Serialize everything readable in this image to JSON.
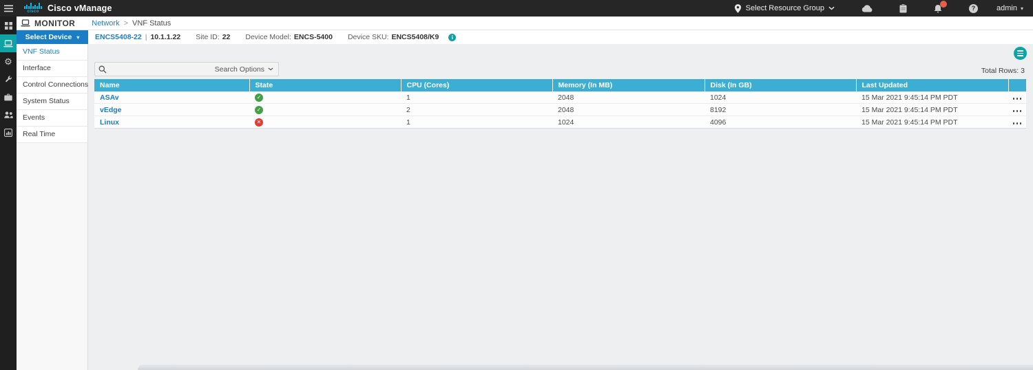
{
  "topbar": {
    "logo_text": "cisco",
    "brand": "Cisco vManage",
    "resource_group_label": "Select Resource Group",
    "username": "admin"
  },
  "titlebar": {
    "section": "MONITOR",
    "breadcrumb_parent": "Network",
    "breadcrumb_separator": ">",
    "breadcrumb_current": "VNF Status"
  },
  "sidebar": {
    "select_device_label": "Select Device",
    "active_item": "VNF Status",
    "items": [
      "VNF Status",
      "Interface",
      "Control Connections",
      "System Status",
      "Events",
      "Real Time"
    ]
  },
  "device_bar": {
    "device_name": "ENCS5408-22",
    "separator": "|",
    "ip": "10.1.1.22",
    "site_id_label": "Site ID:",
    "site_id_value": "22",
    "model_label": "Device Model:",
    "model_value": "ENCS-5400",
    "sku_label": "Device SKU:",
    "sku_value": "ENCS5408/K9"
  },
  "toolbar": {
    "search_value": "",
    "search_options_label": "Search Options",
    "total_rows_label": "Total Rows:",
    "total_rows_value": "3"
  },
  "table": {
    "columns": [
      "Name",
      "State",
      "CPU (Cores)",
      "Memory (In MB)",
      "Disk (In GB)",
      "Last Updated",
      ""
    ],
    "rows": [
      {
        "name": "ASAv",
        "state": "up",
        "cpu": "1",
        "memory": "2048",
        "disk": "1024",
        "last_updated": "15 Mar 2021 9:45:14 PM PDT"
      },
      {
        "name": "vEdge",
        "state": "up",
        "cpu": "2",
        "memory": "2048",
        "disk": "8192",
        "last_updated": "15 Mar 2021 9:45:14 PM PDT"
      },
      {
        "name": "Linux",
        "state": "down",
        "cpu": "1",
        "memory": "1024",
        "disk": "4096",
        "last_updated": "15 Mar 2021 9:45:14 PM PDT"
      }
    ]
  },
  "icons": {
    "hamburger-menu": "three horizontal bars",
    "apps-grid": "grid of squares",
    "monitor": "laptop screen (active, teal)",
    "configuration": "gear",
    "tools": "wrench",
    "maintenance": "toolbox",
    "administration": "two users",
    "analytics": "bar chart panel",
    "location-pin": "map pin",
    "cloud": "cloud",
    "tasks": "clipboard",
    "notifications": "bell with red badge",
    "help": "question mark circle",
    "search": "magnifier",
    "table-menu": "list lines in teal circle",
    "row-actions": "horizontal ellipsis",
    "info": "i in teal circle",
    "status-up": "white check in green circle",
    "status-down": "white cross in red circle"
  },
  "colors": {
    "accent_blue": "#1b7dc3",
    "brand_cyan": "#00bceb",
    "teal": "#0fa3a3",
    "table_header_blue": "#3daed3",
    "status_up_green": "#43a047",
    "status_down_red": "#e53935",
    "badge_red": "#e8604c",
    "topbar_bg": "#262626"
  }
}
